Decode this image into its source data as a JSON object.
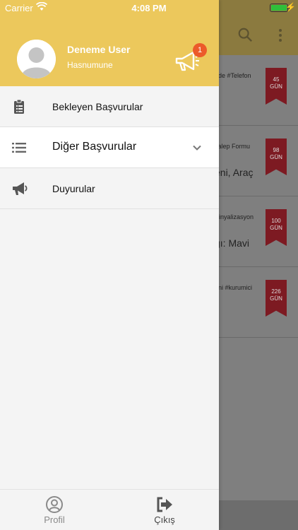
{
  "status_bar": {
    "carrier": "Carrier",
    "time": "4:08 PM"
  },
  "user": {
    "name": "Deneme User",
    "subtitle": "Hasnumune",
    "notification_count": "1"
  },
  "menu": {
    "items": [
      {
        "label": "Bekleyen Başvurular",
        "icon": "clipboard-icon"
      },
      {
        "label": "Diğer Başvurular",
        "icon": "list-icon"
      },
      {
        "label": "Duyurular",
        "icon": "megaphone-icon"
      }
    ]
  },
  "footer": {
    "profile_label": "Profil",
    "logout_label": "Çıkış"
  },
  "background_list": [
    {
      "tag": "ede  #Telefon",
      "title": "",
      "days": "45",
      "unit": "GÜN"
    },
    {
      "tag": "Talep Formu",
      "title": "eni, Araç",
      "days": "98",
      "unit": "GÜN"
    },
    {
      "tag": "Sinyalizasyon",
      "title": "ğı: Mavi",
      "days": "100",
      "unit": "GÜN"
    },
    {
      "tag": "eni  #kurumici",
      "title": "",
      "days": "226",
      "unit": "GÜN"
    }
  ],
  "colors": {
    "header_yellow": "#ecc85c",
    "badge": "#ec5a2a",
    "ribbon": "#c8323e"
  }
}
